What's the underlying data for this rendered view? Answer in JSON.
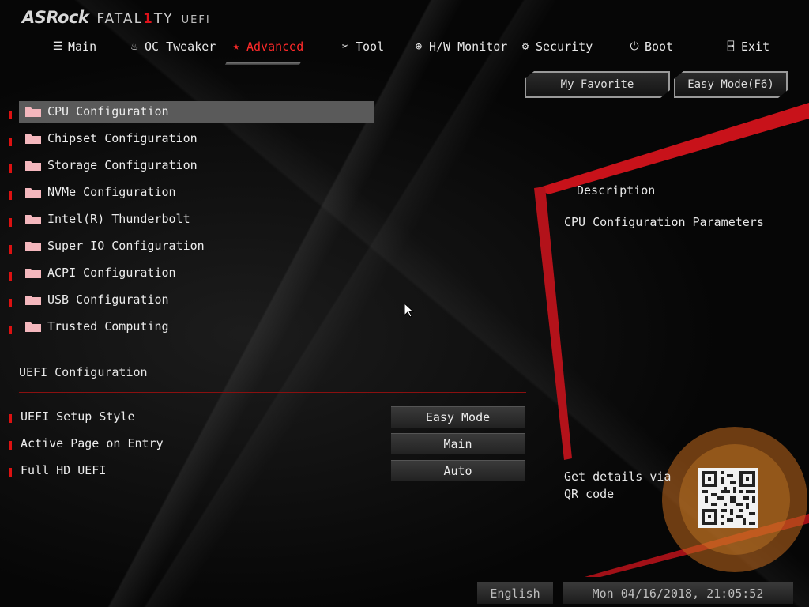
{
  "logo": {
    "brand": "ASRock",
    "sub_pre": "FATAL",
    "sub_one": "1",
    "sub_post": "TY",
    "uefi": "UEFI"
  },
  "nav": {
    "tabs": [
      {
        "label": "Main",
        "icon": "list-icon"
      },
      {
        "label": "OC Tweaker",
        "icon": "rocket-icon"
      },
      {
        "label": "Advanced",
        "icon": "star-icon",
        "active": true
      },
      {
        "label": "Tool",
        "icon": "tools-icon"
      },
      {
        "label": "H/W Monitor",
        "icon": "crosshair-icon"
      },
      {
        "label": "Security",
        "icon": "shield-gear-icon"
      },
      {
        "label": "Boot",
        "icon": "power-icon"
      },
      {
        "label": "Exit",
        "icon": "exit-door-icon"
      }
    ]
  },
  "buttons": {
    "favorite": "My Favorite",
    "easy_mode": "Easy Mode(F6)"
  },
  "menu": {
    "items": [
      "CPU Configuration",
      "Chipset Configuration",
      "Storage Configuration",
      "NVMe Configuration",
      "Intel(R) Thunderbolt",
      "Super IO Configuration",
      "ACPI Configuration",
      "USB Configuration",
      "Trusted Computing"
    ],
    "selected_index": 0
  },
  "uefi_config": {
    "title": "UEFI Configuration",
    "settings": [
      {
        "label": "UEFI Setup Style",
        "value": "Easy Mode"
      },
      {
        "label": "Active Page on Entry",
        "value": "Main"
      },
      {
        "label": "Full HD UEFI",
        "value": "Auto"
      }
    ]
  },
  "description": {
    "title": "Description",
    "text": "CPU Configuration Parameters",
    "qr_text": "Get details via QR code"
  },
  "status": {
    "language": "English",
    "datetime": "Mon 04/16/2018, 21:05:52"
  },
  "colors": {
    "accent": "#e0121b",
    "selected_bg": "#5a5a5a",
    "folder": "#f4b7bd"
  }
}
